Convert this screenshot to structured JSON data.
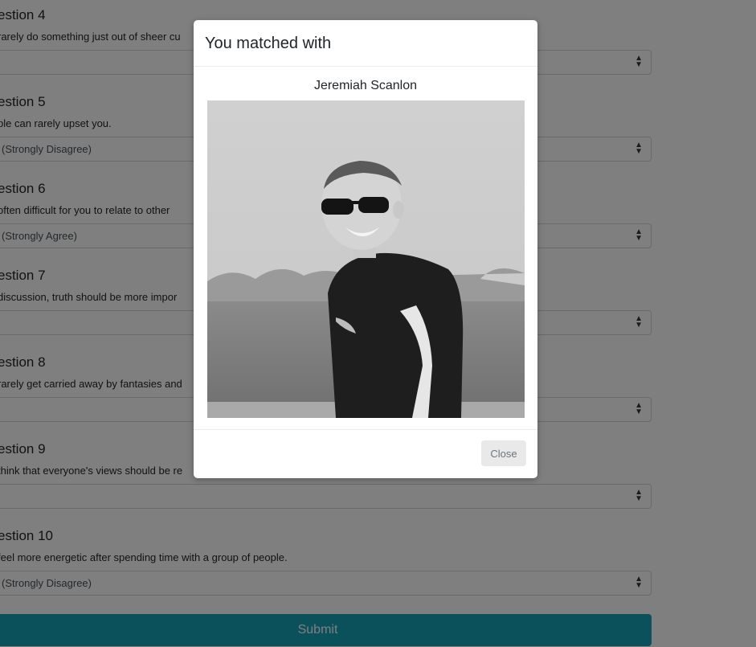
{
  "questions": [
    {
      "title": "estion 4",
      "text": "rarely do something just out of sheer cu",
      "answer": ""
    },
    {
      "title": "estion 5",
      "text": "ple can rarely upset you.",
      "answer": "(Strongly Disagree)"
    },
    {
      "title": "estion 6",
      "text": "often difficult for you to relate to other",
      "answer": "(Strongly Agree)"
    },
    {
      "title": "estion 7",
      "text": "discussion, truth should be more impor",
      "answer": ""
    },
    {
      "title": "estion 8",
      "text": "rarely get carried away by fantasies and",
      "answer": ""
    },
    {
      "title": "estion 9",
      "text": "think that everyone's views should be re",
      "answer": ""
    },
    {
      "title": "estion 10",
      "text": "feel more energetic after spending time with a group of people.",
      "answer": "(Strongly Disagree)"
    }
  ],
  "submit_label": "Submit",
  "modal": {
    "title": "You matched with",
    "match_name": "Jeremiah Scanlon",
    "close_label": "Close"
  },
  "icons": {
    "select_chevron": "updown-caret-icon",
    "photo": "profile-photo"
  },
  "colors": {
    "submit": "#17a2b8",
    "backdrop": "rgba(0,0,0,0.5)"
  }
}
